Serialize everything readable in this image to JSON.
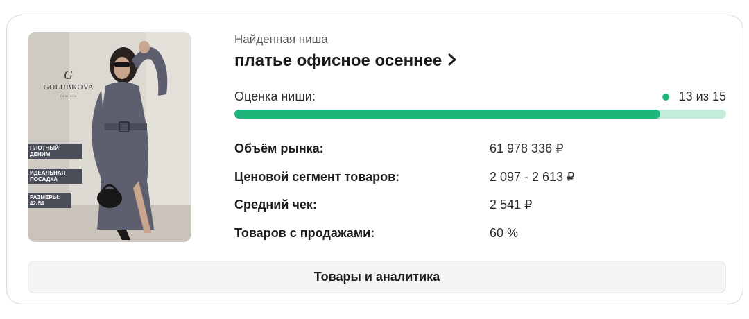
{
  "product_image": {
    "brand": "GOLUBKOVA",
    "brand_sub": "FASHION",
    "brand_mark": "G",
    "promo_labels": [
      "ПЛОТНЫЙ ДЕНИМ",
      "ИДЕАЛЬНАЯ ПОСАДКА",
      "РАЗМЕРЫ: 42-54"
    ],
    "image_icon": "model-in-grey-dress-photo"
  },
  "niche": {
    "caption": "Найденная ниша",
    "title": "платье офисное осеннее",
    "title_icon": "chevron-right-icon"
  },
  "rating": {
    "label": "Оценка ниши:",
    "value_text": "13 из 15",
    "score": 13,
    "max": 15
  },
  "metrics": [
    {
      "label": "Объём рынка:",
      "value": "61 978 336 ₽"
    },
    {
      "label": "Ценовой сегмент товаров:",
      "value": "2 097 - 2 613 ₽"
    },
    {
      "label": "Средний чек:",
      "value": "2 541 ₽"
    },
    {
      "label": "Товаров с продажами:",
      "value": "60 %"
    }
  ],
  "cta": {
    "label": "Товары и аналитика"
  },
  "colors": {
    "accent_green": "#1db57a",
    "track_green_light": "#c3ecd9",
    "dress": "#5d5f6e",
    "wall": "#d9d5cf"
  }
}
